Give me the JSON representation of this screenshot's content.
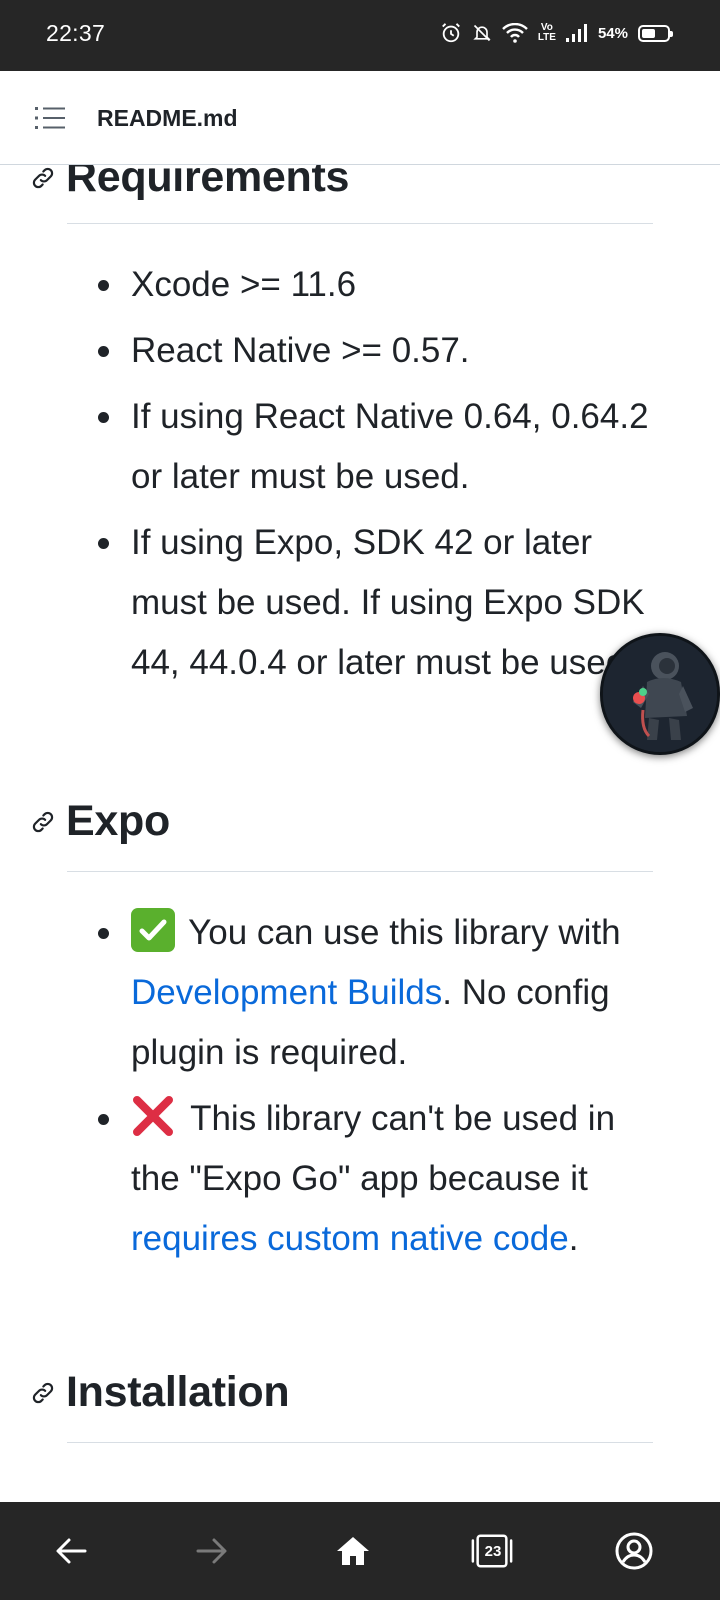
{
  "status_bar": {
    "time": "22:37",
    "network_label_top": "Vo",
    "network_label_bottom": "LTE",
    "battery_percent": "54%",
    "battery_level": 0.54
  },
  "top_bar": {
    "menu_icon": "list-menu-icon",
    "title": "README.md"
  },
  "sections": {
    "requirements": {
      "heading": "Requirements",
      "items": [
        "Xcode >= 11.6",
        "React Native >= 0.57.",
        "If using React Native 0.64, 0.64.2 or later must be used.",
        "If using Expo, SDK 42 or later must be used. If using Expo SDK 44, 44.0.4 or later must be used."
      ]
    },
    "expo": {
      "heading": "Expo",
      "item1": {
        "emoji": "check-mark-button-icon",
        "text_before": " You can use this library with ",
        "link": "Development Builds",
        "text_after": ". No config plugin is required."
      },
      "item2": {
        "emoji": "cross-mark-icon",
        "text_before": " This library can't be used in the \"Expo Go\" app because it ",
        "link": "requires custom native code",
        "text_after": "."
      }
    },
    "installation": {
      "heading": "Installation"
    }
  },
  "nav_bar": {
    "back_icon": "arrow-left-icon",
    "forward_icon": "arrow-right-icon",
    "home_icon": "home-icon",
    "tabs_count": "23",
    "account_icon": "account-icon"
  },
  "colors": {
    "link": "#0969da",
    "status_bar_bg": "#262626",
    "text": "#1f2328"
  }
}
